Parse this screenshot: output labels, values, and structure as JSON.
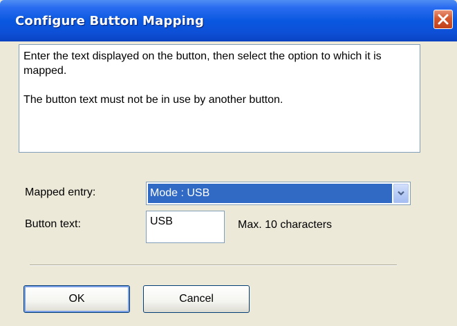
{
  "window": {
    "title": "Configure Button Mapping",
    "close_icon": "close-icon"
  },
  "instructions": {
    "line1": "Enter the text displayed on the button, then select the option to which it is mapped.",
    "line2": "The button text must not be in use by another button."
  },
  "form": {
    "mapped_entry_label": "Mapped entry:",
    "mapped_entry_value": "Mode : USB",
    "button_text_label": "Button text:",
    "button_text_value": "USB",
    "button_text_hint": "Max. 10 characters"
  },
  "buttons": {
    "ok": "OK",
    "cancel": "Cancel"
  },
  "colors": {
    "title_bar": "#0a58e0",
    "selection": "#316ac5",
    "close": "#d2572f"
  }
}
